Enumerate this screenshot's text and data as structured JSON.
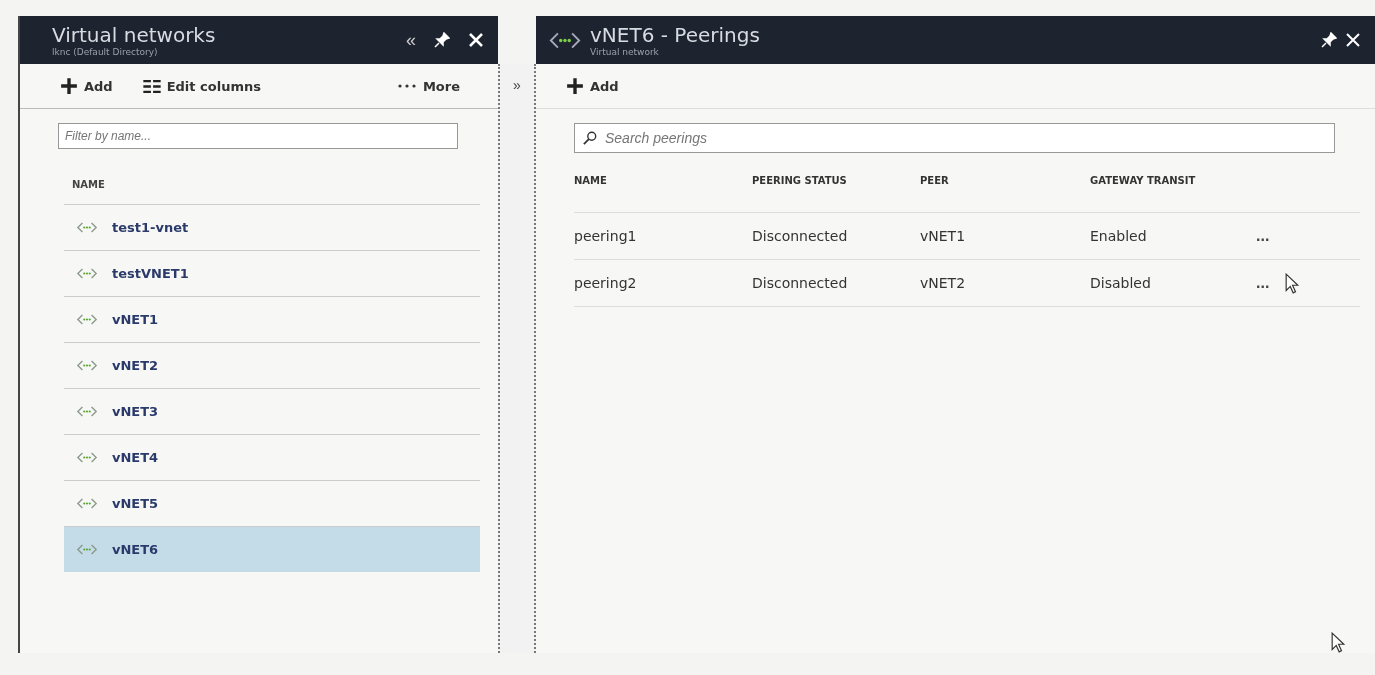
{
  "left_blade": {
    "title": "Virtual networks",
    "subtitle": "lknc (Default Directory)",
    "collapse": "«",
    "toolbar": [
      {
        "kind": "add",
        "label": "Add"
      },
      {
        "kind": "columns",
        "label": "Edit columns"
      },
      {
        "kind": "more",
        "label": "More"
      }
    ],
    "filter": {
      "placeholder": "Filter by name..."
    },
    "column": "NAME",
    "networks": [
      {
        "name": "test1-vnet",
        "selected": false
      },
      {
        "name": "testVNET1",
        "selected": false
      },
      {
        "name": "vNET1",
        "selected": false
      },
      {
        "name": "vNET2",
        "selected": false
      },
      {
        "name": "vNET3",
        "selected": false
      },
      {
        "name": "vNET4",
        "selected": false
      },
      {
        "name": "vNET5",
        "selected": false
      },
      {
        "name": "vNET6",
        "selected": true
      }
    ]
  },
  "expand": "»",
  "right_blade": {
    "title": "vNET6 - Peerings",
    "subtitle": "Virtual network",
    "toolbar": [
      {
        "kind": "add",
        "label": "Add"
      }
    ],
    "search": {
      "placeholder": "Search peerings"
    },
    "columns": [
      "NAME",
      "PEERING STATUS",
      "PEER",
      "GATEWAY TRANSIT"
    ],
    "rows": [
      {
        "name": "peering1",
        "status": "Disconnected",
        "peer": "vNET1",
        "transit": "Enabled",
        "more": "..."
      },
      {
        "name": "peering2",
        "status": "Disconnected",
        "peer": "vNET2",
        "transit": "Disabled",
        "more": "..."
      }
    ]
  }
}
